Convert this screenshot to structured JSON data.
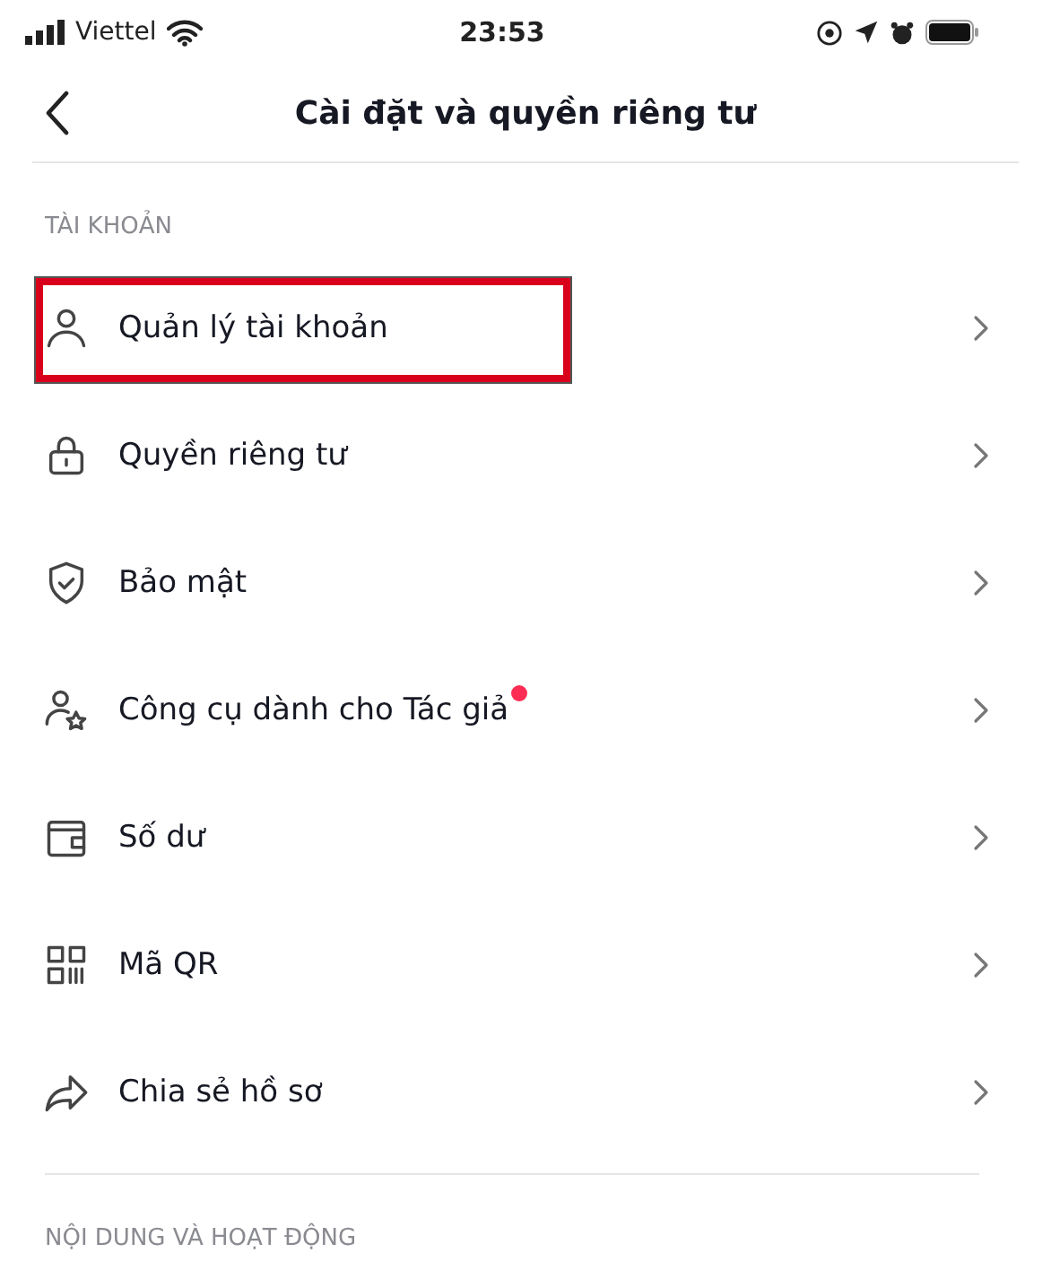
{
  "status_bar": {
    "carrier": "Viettel",
    "time": "23:53"
  },
  "nav": {
    "title": "Cài đặt và quyền riêng tư"
  },
  "sections": [
    {
      "title": "TÀI KHOẢN",
      "items": [
        {
          "kind": "user",
          "label": "Quản lý tài khoản",
          "highlighted": true,
          "badge_dot": false
        },
        {
          "kind": "lock",
          "label": "Quyền riêng tư",
          "highlighted": false,
          "badge_dot": false
        },
        {
          "kind": "shield",
          "label": "Bảo mật",
          "highlighted": false,
          "badge_dot": false
        },
        {
          "kind": "creator",
          "label": "Công cụ dành cho Tác giả",
          "highlighted": false,
          "badge_dot": true
        },
        {
          "kind": "wallet",
          "label": "Số dư",
          "highlighted": false,
          "badge_dot": false
        },
        {
          "kind": "qr",
          "label": "Mã QR",
          "highlighted": false,
          "badge_dot": false
        },
        {
          "kind": "share",
          "label": "Chia sẻ hồ sơ",
          "highlighted": false,
          "badge_dot": false
        }
      ]
    },
    {
      "title": "NỘI DUNG VÀ HOẠT ĐỘNG"
    }
  ]
}
